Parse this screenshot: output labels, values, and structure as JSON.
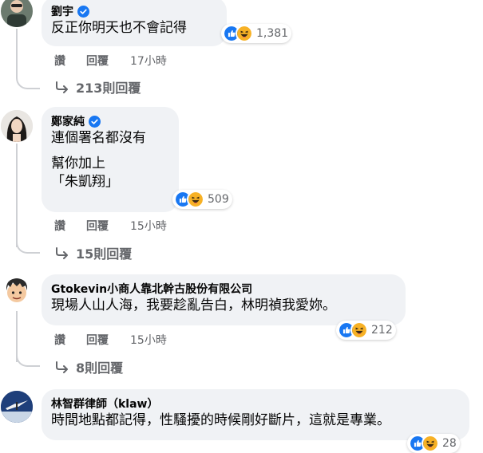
{
  "comments": [
    {
      "author": "劉宇",
      "verified": true,
      "lines": [
        "反正你明天也不會記得"
      ],
      "reaction_count": "1,381",
      "actions": {
        "like": "讚",
        "reply": "回覆",
        "time": "17小時"
      },
      "replies_label": "213則回覆"
    },
    {
      "author": "鄭家純",
      "verified": true,
      "lines": [
        "連個署名都沒有",
        "幫你加上",
        "「朱凱翔」"
      ],
      "reaction_count": "509",
      "actions": {
        "like": "讚",
        "reply": "回覆",
        "time": "15小時"
      },
      "replies_label": "15則回覆"
    },
    {
      "author": "Gtokevin小商人靠北幹古股份有限公司",
      "verified": false,
      "lines": [
        "現場人山人海，我要趁亂告白，林明禎我愛妳。"
      ],
      "reaction_count": "212",
      "actions": {
        "like": "讚",
        "reply": "回覆",
        "time": "15小時"
      },
      "replies_label": "8則回覆"
    },
    {
      "author": "林智群律師（klaw）",
      "verified": false,
      "lines": [
        "時間地點都記得，性騷擾的時候剛好斷片，這就是專業。"
      ],
      "reaction_count": "28"
    }
  ],
  "icons": {
    "like": "like-reaction-icon",
    "haha": "haha-reaction-icon",
    "verified": "verified-badge-icon",
    "reply_arrow": "reply-arrow-icon"
  },
  "colors": {
    "bubble": "#f0f2f5",
    "meta_text": "#65676b",
    "like_blue": "#1877f2",
    "haha_yellow": "#f7b125",
    "thread_line": "#ced0d4"
  }
}
